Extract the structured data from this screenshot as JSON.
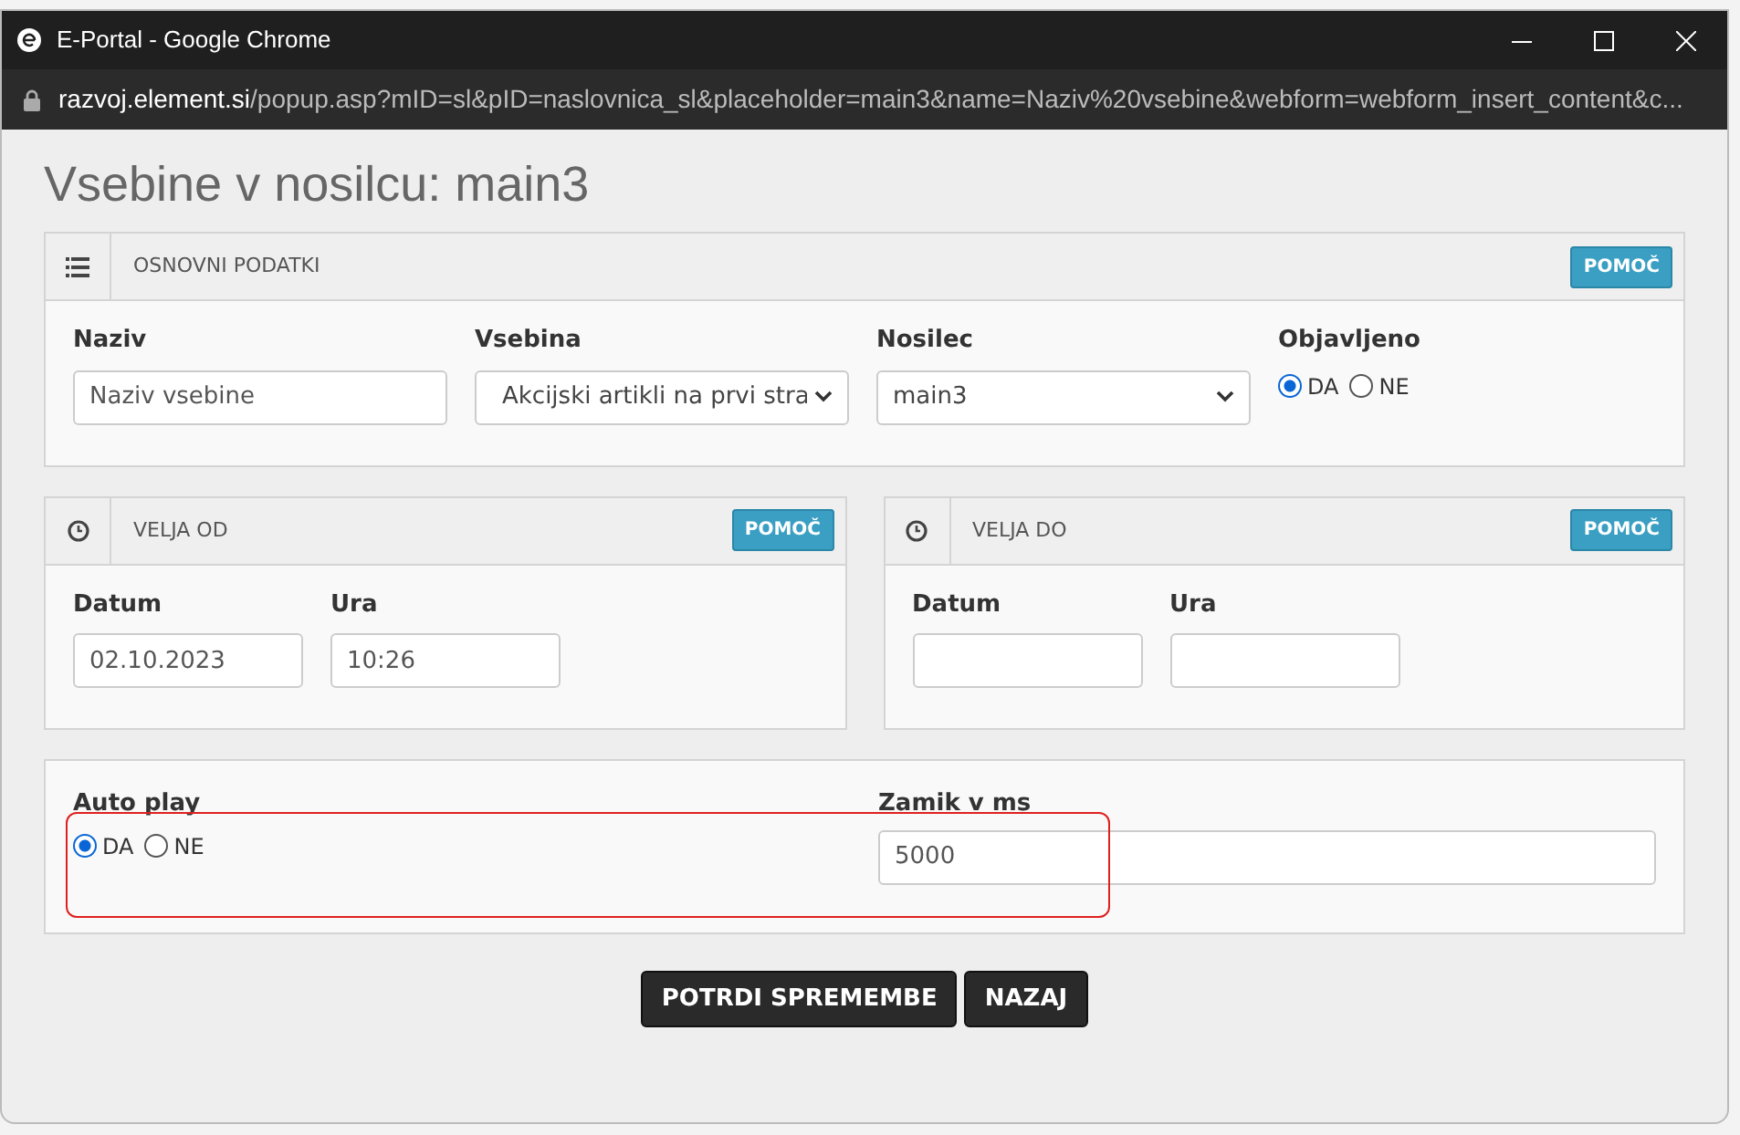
{
  "window": {
    "title": "E-Portal - Google Chrome",
    "url_host": "razvoj.element.si",
    "url_path": "/popup.asp?mID=sl&pID=naslovnica_sl&placeholder=main3&name=Naziv%20vsebine&webform=webform_insert_content&c..."
  },
  "heading": "Vsebine v nosilcu: main3",
  "basic_panel": {
    "title": "OSNOVNI PODATKI",
    "help_button": "POMOČ",
    "fields": [
      {
        "kind": "text",
        "label": "Naziv",
        "value": "Naziv vsebine"
      },
      {
        "kind": "select",
        "label": "Vsebina",
        "value": "Akcijski artikli na prvi stra"
      },
      {
        "kind": "select",
        "label": "Nosilec",
        "value": "main3"
      },
      {
        "kind": "radio",
        "label": "Objavljeno",
        "options": [
          {
            "label": "DA",
            "selected": true
          },
          {
            "label": "NE",
            "selected": false
          }
        ]
      }
    ]
  },
  "validity_panels": [
    {
      "title": "VELJA OD",
      "help_button": "POMOČ",
      "date_label": "Datum",
      "date_value": "02.10.2023",
      "time_label": "Ura",
      "time_value": "10:26"
    },
    {
      "title": "VELJA DO",
      "help_button": "POMOČ",
      "date_label": "Datum",
      "time_label": "Ura"
    }
  ],
  "autoplay_panel": {
    "highlighted": true,
    "autoplay_label": "Auto play",
    "options": [
      {
        "label": "DA",
        "selected": true
      },
      {
        "label": "NE",
        "selected": false
      }
    ],
    "delay_label": "Zamik v ms",
    "delay_value": "5000"
  },
  "buttons": [
    "POTRDI SPREMEMBE",
    "NAZAJ"
  ]
}
